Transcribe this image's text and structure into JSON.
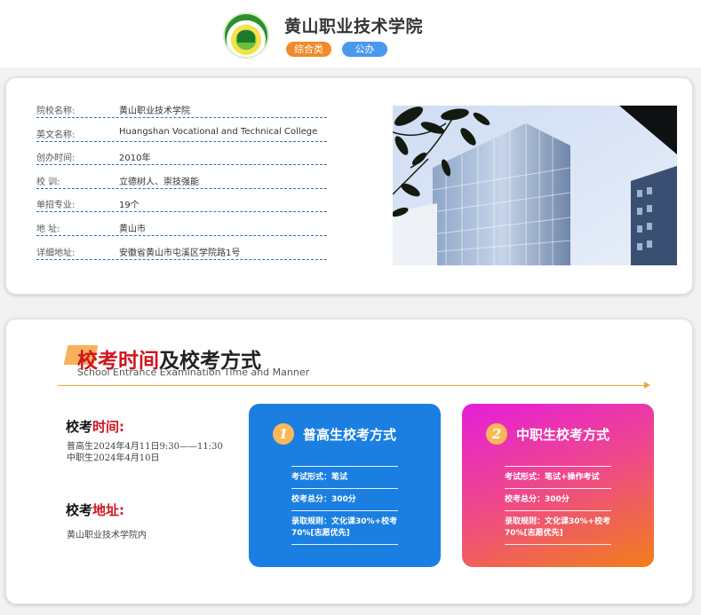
{
  "header": {
    "school_name": "黄山职业技术学院",
    "tags": [
      "综合类",
      "公办"
    ]
  },
  "info": {
    "rows": [
      {
        "key": "院校名称:",
        "value": "黄山职业技术学院"
      },
      {
        "key": "英文名称:",
        "value": "Huangshan Vocational and Technical College"
      },
      {
        "key": "创办时间:",
        "value": "2010年"
      },
      {
        "key": "校 训:",
        "value": "立德树人、崇技强能"
      },
      {
        "key": "单招专业:",
        "value": "19个"
      },
      {
        "key": "地 址:",
        "value": "黄山市"
      },
      {
        "key": "详细地址:",
        "value": "安徽省黄山市屯溪区学院路1号"
      }
    ]
  },
  "exam": {
    "title_red": "校考时间",
    "title_rest": "及校考方式",
    "subtitle": "School Entrance Examination Time and Manner",
    "time_label_a": "校考",
    "time_label_b": "时间:",
    "time_lines": [
      "普高生2024年4月11日9:30——11:30",
      "中职生2024年4月10日"
    ],
    "addr_label_a": "校考",
    "addr_label_b": "地址:",
    "address": "黄山职业技术学院内",
    "methods": [
      {
        "num": "1",
        "title": "普高生校考方式",
        "form": "考试形式：笔试",
        "score": "校考总分：300分",
        "rule": "录取规则：文化课30%+校考70%[志愿优先]"
      },
      {
        "num": "2",
        "title": "中职生校考方式",
        "form": "考试形式：笔试+操作考试",
        "score": "校考总分：300分",
        "rule": "录取规则：文化课30%+校考70%[志愿优先]"
      }
    ]
  }
}
